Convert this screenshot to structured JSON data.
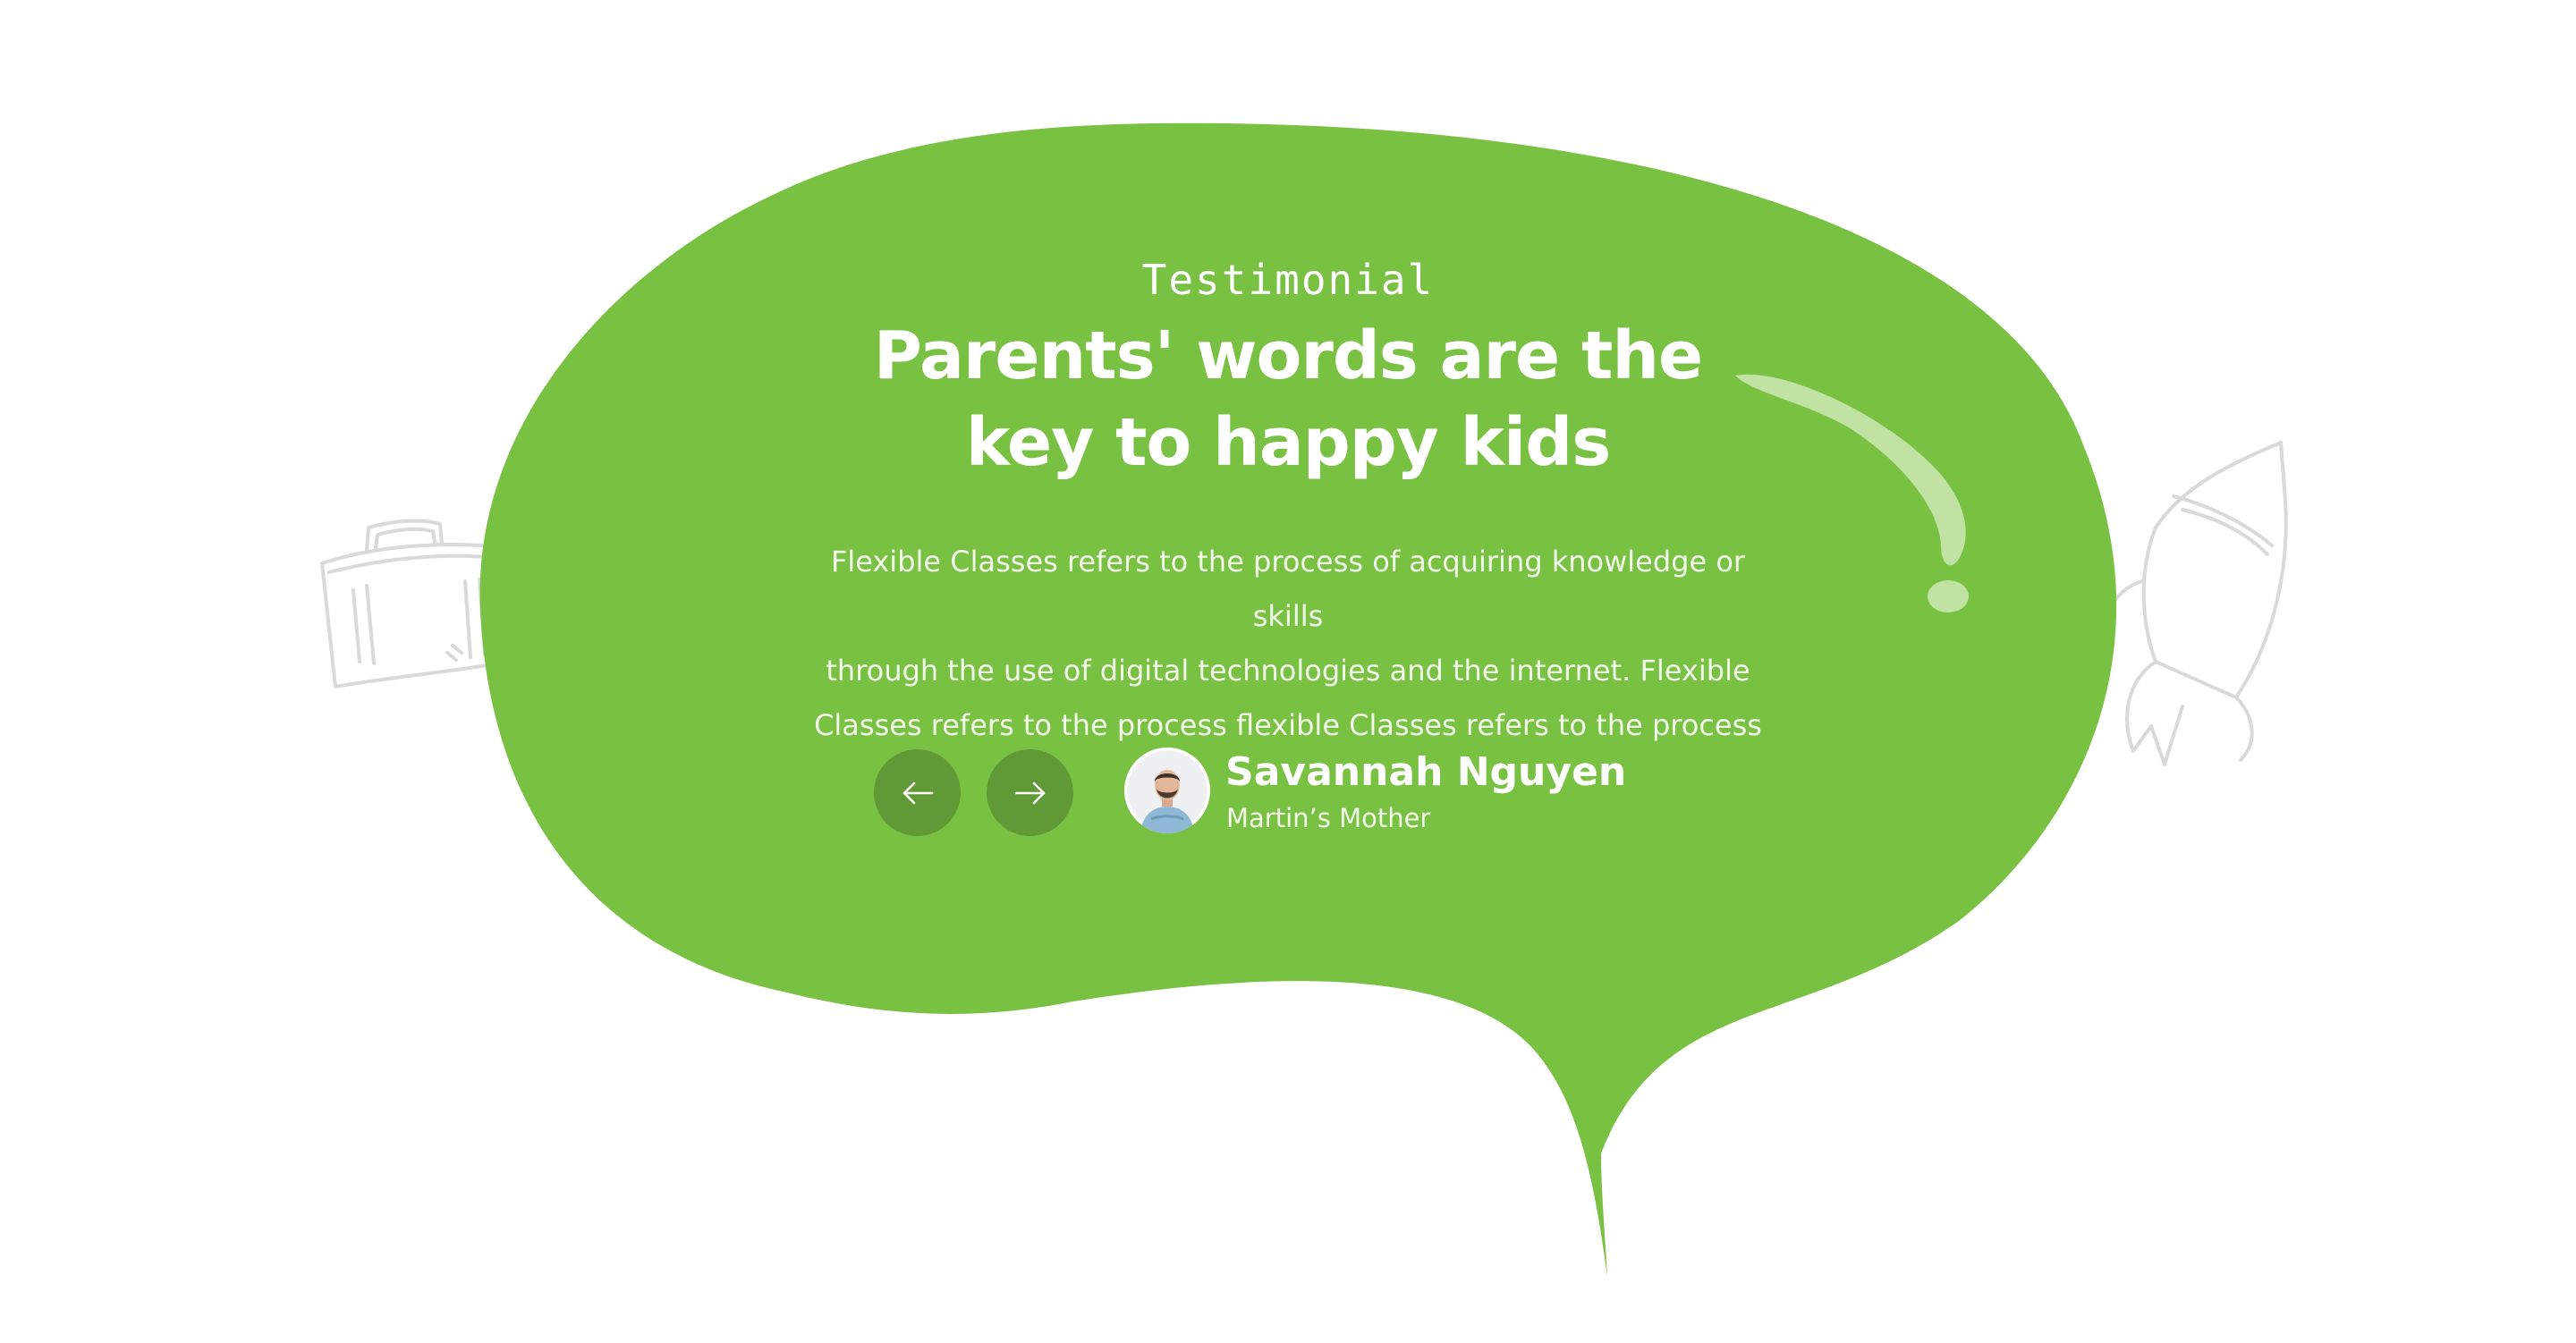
{
  "testimonial": {
    "eyebrow": "Testimonial",
    "headline_line1": "Parents' words are the",
    "headline_line2": "key to happy kids",
    "body_line1": "Flexible Classes refers to the process of acquiring knowledge or skills",
    "body_line2": "through the use of digital technologies and the internet. Flexible",
    "body_line3": "Classes refers to the process flexible Classes refers to the process",
    "author_name": "Savannah Nguyen",
    "author_role": "Martin’s Mother"
  },
  "icons": {
    "prev": "arrow-left-icon",
    "next": "arrow-right-icon",
    "decor_left": "briefcase-sketch-icon",
    "decor_right": "rocket-sketch-icon"
  },
  "colors": {
    "bubble": "#79c143",
    "button": "#5f9a37",
    "text": "#ffffff",
    "sketch": "#d9d9d9"
  }
}
